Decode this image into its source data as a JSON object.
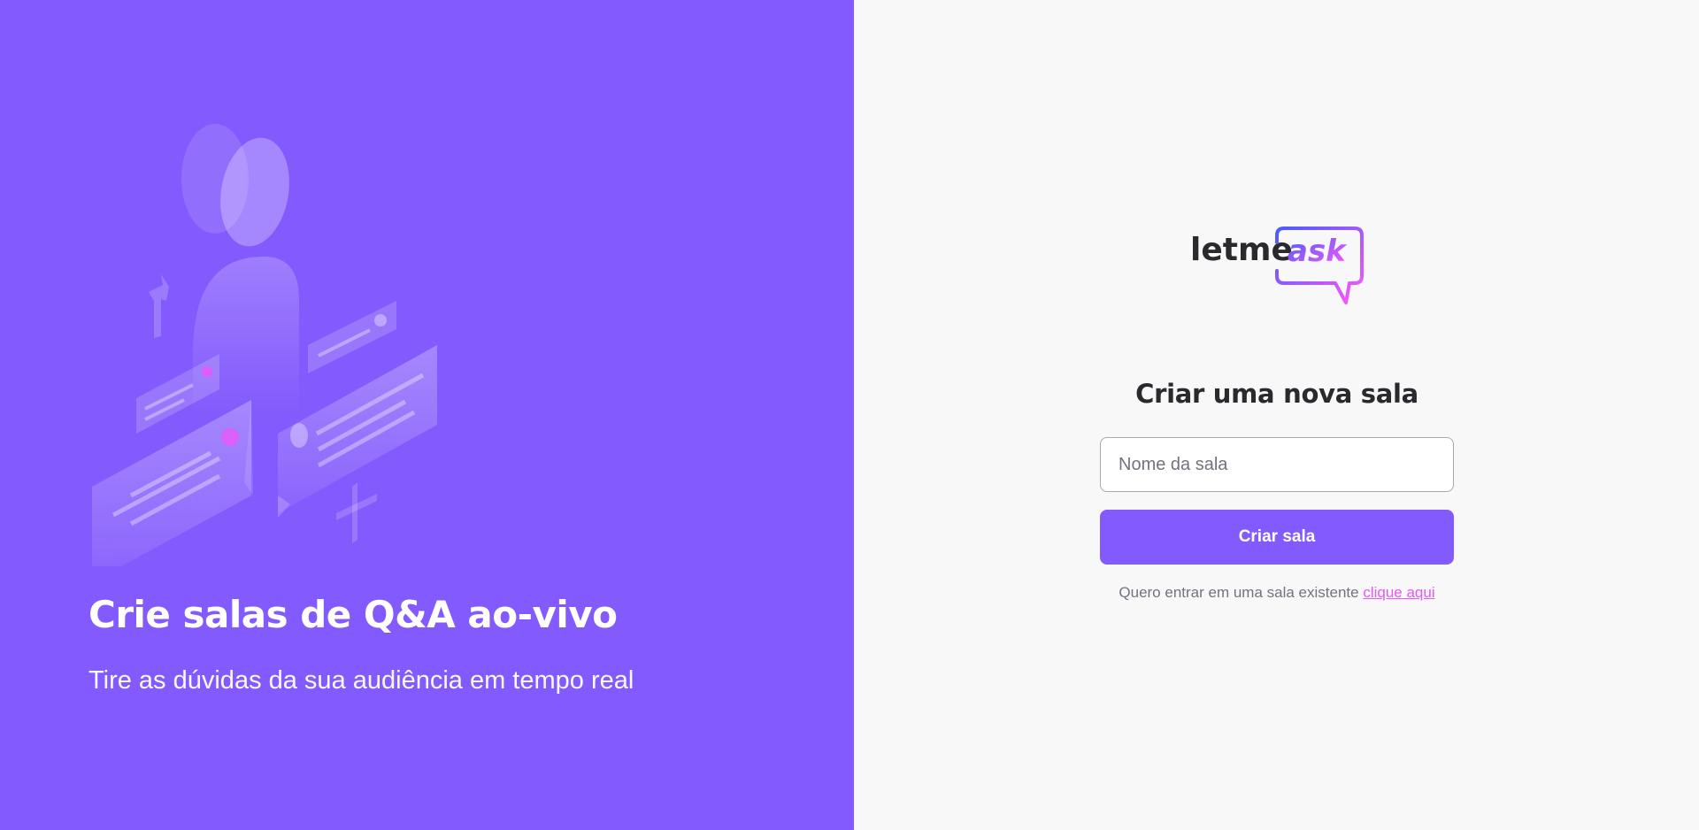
{
  "aside": {
    "title": "Crie salas de Q&A ao-vivo",
    "subtitle": "Tire as dúvidas da sua audiência em tempo real",
    "illustration_icon": "people-chat-illustration"
  },
  "main": {
    "logo": {
      "part1": "letme",
      "part2": "ask",
      "icon": "speech-bubble-logo"
    },
    "form_title": "Criar uma nova sala",
    "room_input": {
      "placeholder": "Nome da sala",
      "value": ""
    },
    "create_button_label": "Criar sala",
    "join_text": "Quero entrar em uma sala existente",
    "join_link_label": "clique aqui"
  },
  "colors": {
    "brand_purple": "#835afd",
    "accent_pink": "#e559f9",
    "background": "#f8f8f8",
    "title_text": "#29292e",
    "muted_text": "#737380"
  }
}
